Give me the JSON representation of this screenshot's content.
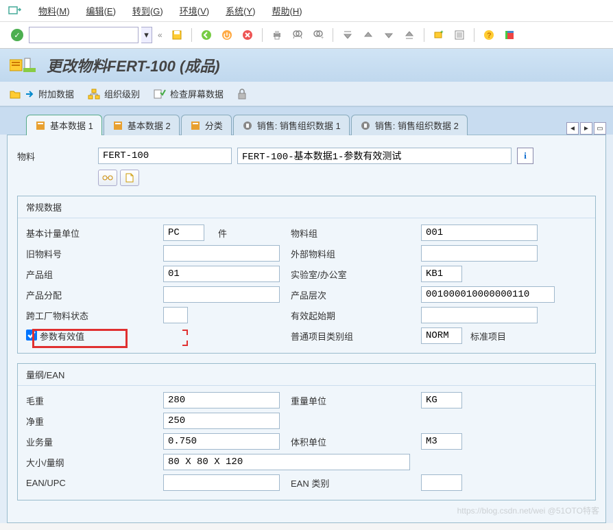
{
  "menu": {
    "items": [
      {
        "label": "物料",
        "key": "M"
      },
      {
        "label": "编辑",
        "key": "E"
      },
      {
        "label": "转到",
        "key": "G"
      },
      {
        "label": "环境",
        "key": "V"
      },
      {
        "label": "系统",
        "key": "Y"
      },
      {
        "label": "帮助",
        "key": "H"
      }
    ]
  },
  "title": "更改物料FERT-100 (成品)",
  "sec_toolbar": {
    "btn1": "附加数据",
    "btn2": "组织级别",
    "btn3": "检查屏幕数据"
  },
  "tabs": [
    {
      "label": "基本数据 1",
      "active": true,
      "icon_color": "#e8a030"
    },
    {
      "label": "基本数据 2",
      "active": false,
      "icon_color": "#e8a030"
    },
    {
      "label": "分类",
      "active": false,
      "icon_color": "#e8a030"
    },
    {
      "label": "销售: 销售组织数据 1",
      "active": false,
      "icon_color": "#888"
    },
    {
      "label": "销售: 销售组织数据 2",
      "active": false,
      "icon_color": "#888"
    }
  ],
  "material": {
    "label": "物料",
    "code": "FERT-100",
    "desc": "FERT-100-基本数据1-参数有效测试"
  },
  "group1": {
    "title": "常规数据",
    "rows": [
      {
        "l1": "基本计量单位",
        "v1": "PC",
        "l2": "件",
        "l3": "物料组",
        "v3": "001"
      },
      {
        "l1": "旧物料号",
        "v1": "",
        "l2": "",
        "l3": "外部物料组",
        "v3": ""
      },
      {
        "l1": "产品组",
        "v1": "01",
        "l2": "",
        "l3": "实验室/办公室",
        "v3": "KB1"
      },
      {
        "l1": "产品分配",
        "v1": "",
        "l2": "",
        "l3": "产品层次",
        "v3": "001000010000000110"
      },
      {
        "l1": "跨工厂物料状态",
        "v1": "",
        "l2": "",
        "l3": "有效起始期",
        "v3": ""
      },
      {
        "l1": "参数有效值",
        "checkbox": true,
        "l3": "普通项目类别组",
        "v3": "NORM",
        "extra": "标准项目"
      }
    ]
  },
  "group2": {
    "title": "量纲/EAN",
    "rows": [
      {
        "l1": "毛重",
        "v1": "280",
        "l3": "重量单位",
        "v3": "KG"
      },
      {
        "l1": "净重",
        "v1": "250",
        "l3": "",
        "v3": ""
      },
      {
        "l1": "业务量",
        "v1": "0.750",
        "l3": "体积单位",
        "v3": "M3"
      },
      {
        "l1": "大小/量纲",
        "v1": "80 X 80 X 120",
        "wide": true
      },
      {
        "l1": "EAN/UPC",
        "v1": "",
        "l3": "EAN 类别",
        "v3": ""
      }
    ]
  },
  "watermark": "https://blog.csdn.net/wei @51OTO特客"
}
